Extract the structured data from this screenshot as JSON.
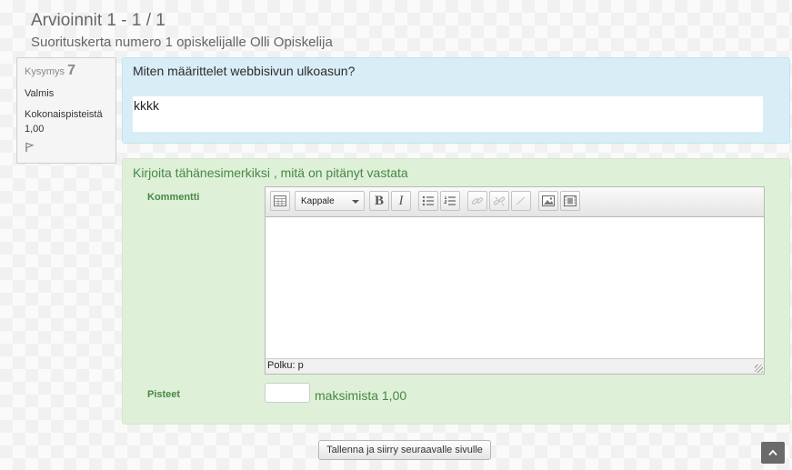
{
  "header": {
    "title": "Arvioinnit 1 - 1 / 1",
    "subtitle": "Suorituskerta numero 1 opiskelijalle Olli Opiskelija"
  },
  "question_info": {
    "label": "Kysymys",
    "number": "7",
    "state": "Valmis",
    "grade_label": "Kokonaispisteistä",
    "grade_value": "1,00",
    "flag_icon": "flag-icon"
  },
  "question": {
    "text": "Miten määrittelet webbisivun ulkoasun?",
    "answer": "kkkk"
  },
  "grading": {
    "instruction": "Kirjoita tähänesimerkiksi , mitä on pitänyt vastata",
    "comment_label": "Kommentti",
    "editor": {
      "format_select": "Kappale",
      "path_label": "Polku: p",
      "content": "",
      "toolbar_icons": [
        "toggle-toolbar-icon",
        "bold-icon",
        "italic-icon",
        "unordered-list-icon",
        "ordered-list-icon",
        "link-icon",
        "unlink-icon",
        "anchor-icon",
        "image-icon",
        "media-icon"
      ]
    },
    "mark_label": "Pisteet",
    "mark_value": "",
    "mark_max": "maksimista 1,00"
  },
  "actions": {
    "save_next": "Tallenna ja siirry seuraavalle sivulle",
    "back_to_top_icon": "chevron-up-icon"
  },
  "colors": {
    "formulation_bg": "#d9edf7",
    "comment_bg": "#dff0d8",
    "comment_text": "#468847"
  }
}
